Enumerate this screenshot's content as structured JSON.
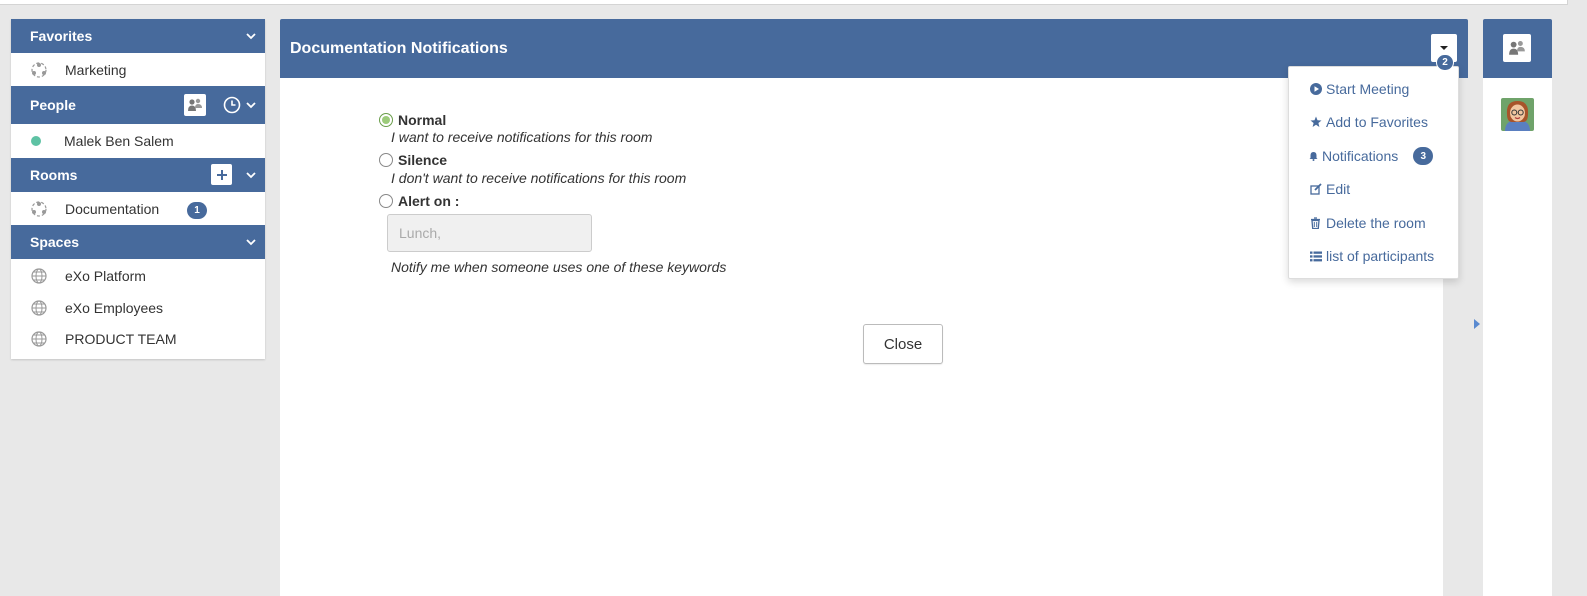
{
  "sidebar": {
    "favorites": {
      "title": "Favorites",
      "items": [
        {
          "label": "Marketing"
        }
      ]
    },
    "people": {
      "title": "People",
      "items": [
        {
          "label": "Malek Ben Salem",
          "status": "online"
        }
      ]
    },
    "rooms": {
      "title": "Rooms",
      "items": [
        {
          "label": "Documentation",
          "badge": "1"
        }
      ]
    },
    "spaces": {
      "title": "Spaces",
      "items": [
        {
          "label": "eXo Platform"
        },
        {
          "label": "eXo Employees"
        },
        {
          "label": "PRODUCT TEAM"
        }
      ]
    }
  },
  "main": {
    "title": "Documentation Notifications",
    "dropdown_badge": "2",
    "options": {
      "normal": {
        "label": "Normal",
        "hint": "I want to receive notifications for this room",
        "checked": true
      },
      "silence": {
        "label": "Silence",
        "hint": "I don't want to receive notifications for this room",
        "checked": false
      },
      "alert": {
        "label": "Alert on :",
        "placeholder": "Lunch,",
        "hint": "Notify me when someone uses one of these keywords",
        "checked": false
      }
    },
    "close_label": "Close"
  },
  "menu": {
    "items": [
      {
        "label": "Start Meeting",
        "icon": "play-circle-icon"
      },
      {
        "label": "Add to Favorites",
        "icon": "star-icon"
      },
      {
        "label": "Notifications",
        "icon": "bell-icon",
        "badge": "3"
      },
      {
        "label": "Edit",
        "icon": "edit-icon"
      },
      {
        "label": "Delete the room",
        "icon": "trash-icon"
      },
      {
        "label": "list of participants",
        "icon": "list-icon"
      }
    ]
  },
  "colors": {
    "brand": "#476a9c",
    "online": "#5ec2a4",
    "radio_checked": "#9ccb7a"
  }
}
